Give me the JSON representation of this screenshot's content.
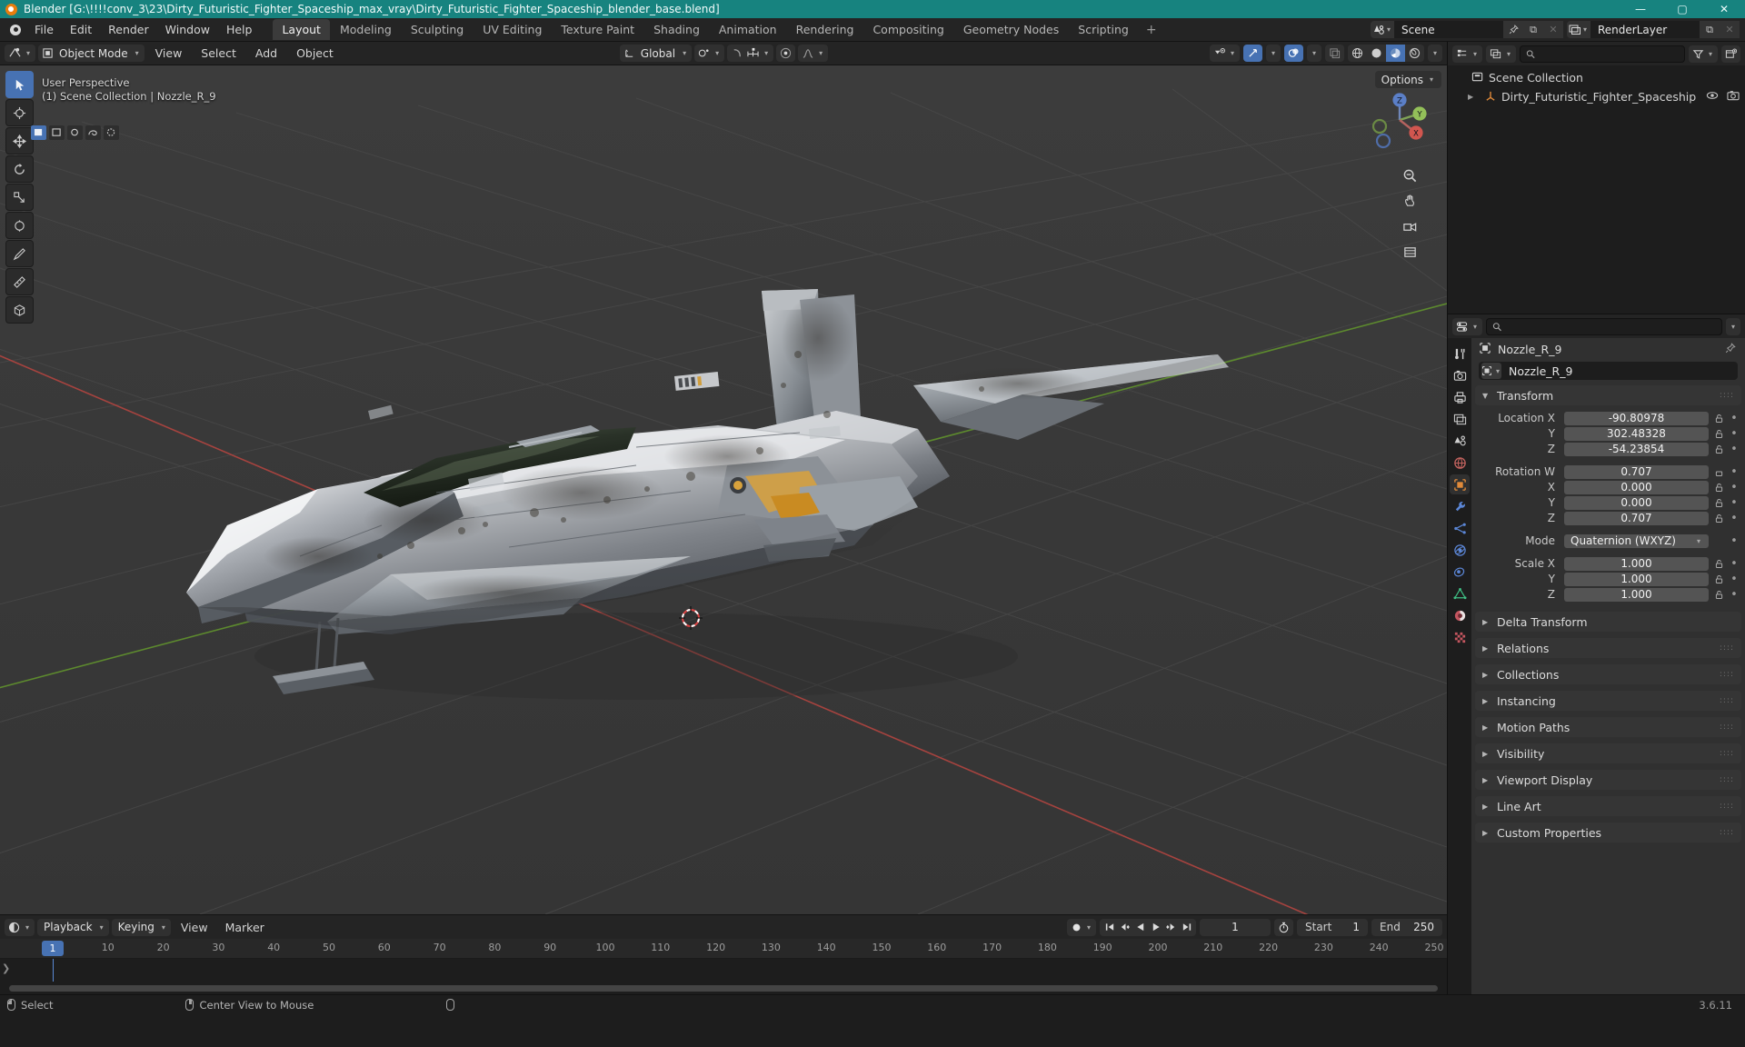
{
  "titlebar": {
    "text": "Blender [G:\\!!!!conv_3\\23\\Dirty_Futuristic_Fighter_Spaceship_max_vray\\Dirty_Futuristic_Fighter_Spaceship_blender_base.blend]",
    "minimize": "—",
    "maximize": "▢",
    "close": "✕",
    "accent_color": "#17837f"
  },
  "topbar": {
    "menus": [
      "File",
      "Edit",
      "Render",
      "Window",
      "Help"
    ],
    "workspaces": [
      {
        "label": "Layout",
        "active": true
      },
      {
        "label": "Modeling",
        "active": false
      },
      {
        "label": "Sculpting",
        "active": false
      },
      {
        "label": "UV Editing",
        "active": false
      },
      {
        "label": "Texture Paint",
        "active": false
      },
      {
        "label": "Shading",
        "active": false
      },
      {
        "label": "Animation",
        "active": false
      },
      {
        "label": "Rendering",
        "active": false
      },
      {
        "label": "Compositing",
        "active": false
      },
      {
        "label": "Geometry Nodes",
        "active": false
      },
      {
        "label": "Scripting",
        "active": false
      }
    ],
    "add_workspace": "+",
    "scene": {
      "name": "Scene",
      "new_btn": "⧉",
      "unlink_btn": "✕"
    },
    "viewlayer": {
      "name": "RenderLayer",
      "new_btn": "⧉",
      "unlink_btn": "✕"
    }
  },
  "viewport": {
    "header": {
      "mode": "Object Mode",
      "menus": [
        "View",
        "Select",
        "Add",
        "Object"
      ],
      "transform_orientation": "Global",
      "options_label": "Options"
    },
    "overlay_text_line1": "User Perspective",
    "overlay_text_line2": "(1) Scene Collection | Nozzle_R_9",
    "gizmo_axes": {
      "z": "Z",
      "y": "Y",
      "x": "X"
    },
    "background_color": "#393939",
    "grid_color": "#4b4b4b",
    "axis_x_color": "#a33b3b",
    "axis_y_color": "#5d8a2e"
  },
  "timeline": {
    "menus": [
      "Playback",
      "Keying",
      "View",
      "Marker"
    ],
    "current_frame": "1",
    "start_label": "Start",
    "start_value": "1",
    "end_label": "End",
    "end_value": "250",
    "ruler_ticks": [
      "1",
      "10",
      "20",
      "30",
      "40",
      "50",
      "60",
      "70",
      "80",
      "90",
      "100",
      "110",
      "120",
      "130",
      "140",
      "150",
      "160",
      "170",
      "180",
      "190",
      "200",
      "210",
      "220",
      "230",
      "240",
      "250"
    ],
    "playhead_frame": "1"
  },
  "outliner": {
    "search_placeholder": "",
    "rows": [
      {
        "label": "Scene Collection",
        "indent": 0,
        "icon": "collection-icon",
        "has_disclosure": false
      },
      {
        "label": "Dirty_Futuristic_Fighter_Spaceship",
        "indent": 1,
        "icon": "empty-axes-icon",
        "has_disclosure": true
      }
    ]
  },
  "properties": {
    "search_placeholder": "",
    "breadcrumb_object": "Nozzle_R_9",
    "object_name_field": "Nozzle_R_9",
    "panels": [
      {
        "label": "Transform",
        "expanded": true
      },
      {
        "label": "Delta Transform",
        "expanded": false
      },
      {
        "label": "Relations",
        "expanded": false
      },
      {
        "label": "Collections",
        "expanded": false
      },
      {
        "label": "Instancing",
        "expanded": false
      },
      {
        "label": "Motion Paths",
        "expanded": false
      },
      {
        "label": "Visibility",
        "expanded": false
      },
      {
        "label": "Viewport Display",
        "expanded": false
      },
      {
        "label": "Line Art",
        "expanded": false
      },
      {
        "label": "Custom Properties",
        "expanded": false
      }
    ],
    "transform": {
      "location": [
        {
          "label": "Location X",
          "value": "-90.80978"
        },
        {
          "label": "Y",
          "value": "302.48328"
        },
        {
          "label": "Z",
          "value": "-54.23854"
        }
      ],
      "rotation": [
        {
          "label": "Rotation W",
          "value": "0.707"
        },
        {
          "label": "X",
          "value": "0.000"
        },
        {
          "label": "Y",
          "value": "0.000"
        },
        {
          "label": "Z",
          "value": "0.707"
        }
      ],
      "mode_label": "Mode",
      "mode_value": "Quaternion (WXYZ)",
      "scale": [
        {
          "label": "Scale X",
          "value": "1.000"
        },
        {
          "label": "Y",
          "value": "1.000"
        },
        {
          "label": "Z",
          "value": "1.000"
        }
      ]
    }
  },
  "statusbar": {
    "items": [
      {
        "mouse": "left",
        "label": "Select"
      },
      {
        "mouse": "middle",
        "label": "Center View to Mouse"
      },
      {
        "mouse": "right",
        "label": ""
      }
    ],
    "version": "3.6.11"
  }
}
